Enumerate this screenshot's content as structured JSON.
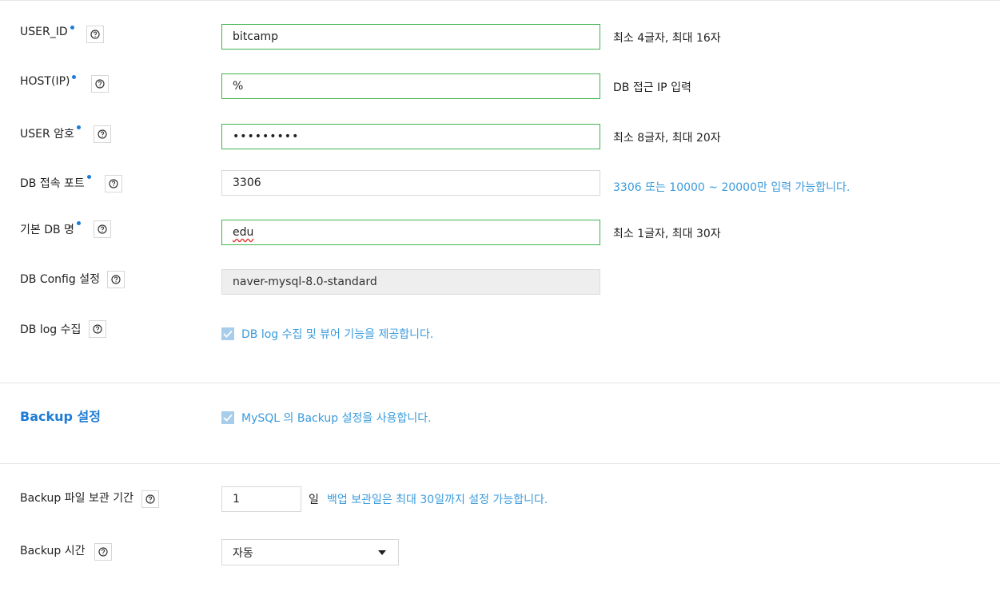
{
  "fields": {
    "user_id": {
      "label": "USER_ID",
      "value": "bitcamp",
      "hint": "최소 4글자, 최대 16자"
    },
    "host_ip": {
      "label": "HOST(IP)",
      "value": "%",
      "hint": "DB 접근 IP 입력"
    },
    "user_password": {
      "label": "USER 암호",
      "value": "•••••••••",
      "hint": "최소 8글자, 최대 20자"
    },
    "db_port": {
      "label": "DB 접속 포트",
      "value": "3306",
      "hint": "3306 또는 10000 ~ 20000만 입력 가능합니다."
    },
    "default_db": {
      "label": "기본 DB 명",
      "value": "edu",
      "hint": "최소 1글자, 최대 30자"
    },
    "db_config": {
      "label": "DB Config 설정",
      "value": "naver-mysql-8.0-standard"
    },
    "db_log": {
      "label": "DB log 수집",
      "checkbox_label": "DB log 수집 및 뷰어 기능을 제공합니다.",
      "checked": true
    }
  },
  "backup": {
    "title": "Backup 설정",
    "checkbox_label": "MySQL 의 Backup 설정을 사용합니다.",
    "checked": true,
    "retention": {
      "label": "Backup 파일 보관 기간",
      "value": "1",
      "unit": "일",
      "hint": "백업 보관일은 최대 30일까지 설정 가능합니다."
    },
    "time": {
      "label": "Backup 시간",
      "selected": "자동"
    }
  },
  "colors": {
    "accent": "#1e7cd6",
    "active_border": "#3fb34f",
    "hint_blue": "#3a9bdc",
    "checkbox": "#a7cdea"
  },
  "icons": {
    "help": "question-circle-icon",
    "required": "required-dot-icon",
    "check": "check-icon",
    "dropdown": "caret-down-icon"
  }
}
